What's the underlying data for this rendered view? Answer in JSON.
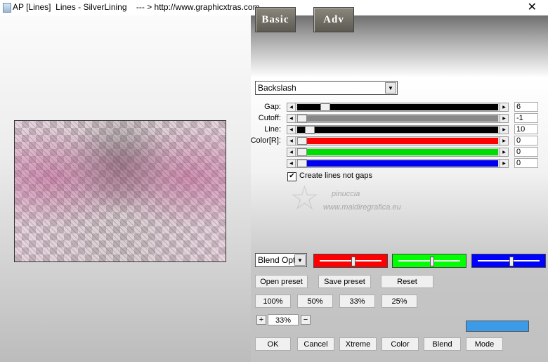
{
  "window": {
    "title": "AP [Lines]  Lines - SilverLining    --- > http://www.graphicxtras.com",
    "close_glyph": "✕"
  },
  "tabs": {
    "basic": "Basic",
    "adv": "Adv"
  },
  "pattern_select": {
    "value": "Backslash"
  },
  "params": [
    {
      "label": "Gap:",
      "value": "6",
      "track_color": "#000000",
      "level": 0.12
    },
    {
      "label": "Cutoff:",
      "value": "-1",
      "track_color": "#888888",
      "level": 0.0
    },
    {
      "label": "Line:",
      "value": "10",
      "track_color": "#000000",
      "level": 0.04
    },
    {
      "label": "Color[R]:",
      "value": "0",
      "track_color": "#ff0000",
      "level": 0.0
    },
    {
      "label": "",
      "value": "0",
      "track_color": "#00dd00",
      "level": 0.0
    },
    {
      "label": "",
      "value": "0",
      "track_color": "#0000ee",
      "level": 0.0
    }
  ],
  "checkbox": {
    "checked_glyph": "✔",
    "label": "Create lines not gaps"
  },
  "watermark": {
    "line1": "pinuccia",
    "line2": "www.maidiregrafica.eu"
  },
  "blend_select": {
    "value": "Blend Optio"
  },
  "color_sliders": [
    {
      "color": "#ff0000",
      "level": 0.55
    },
    {
      "color": "#00ff00",
      "level": 0.55
    },
    {
      "color": "#0000ff",
      "level": 0.55
    }
  ],
  "buttons": {
    "open_preset": "Open preset",
    "save_preset": "Save preset",
    "reset": "Reset",
    "z100": "100%",
    "z50": "50%",
    "z33": "33%",
    "z25": "25%",
    "ok": "OK",
    "cancel": "Cancel",
    "xtreme": "Xtreme",
    "color": "Color",
    "blend": "Blend",
    "mode": "Mode"
  },
  "zoom": {
    "plus": "+",
    "value": "33%",
    "minus": "−"
  },
  "swatch_color": "#3b9be8"
}
